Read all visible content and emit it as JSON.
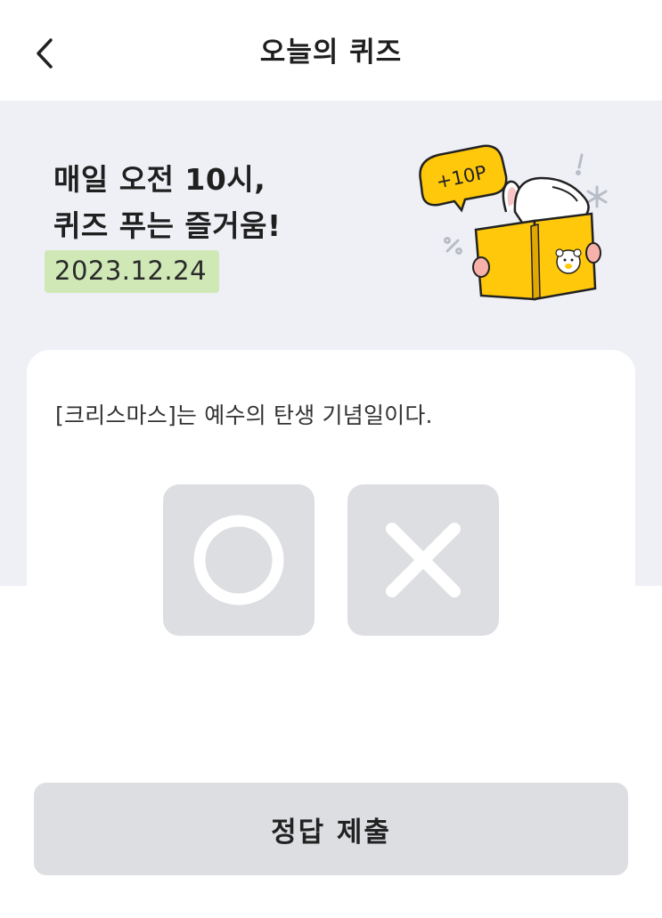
{
  "header": {
    "title": "오늘의 퀴즈",
    "back_icon": "chevron-left-icon"
  },
  "hero": {
    "headline_line1": "매일 오전 10시,",
    "headline_line2": "퀴즈 푸는 즐거움!",
    "date": "2023.12.24",
    "badge_text": "+10P",
    "highlight_color": "#cfe8b6"
  },
  "quiz": {
    "question": "[크리스마스]는 예수의 탄생 기념일이다.",
    "options": [
      {
        "icon": "circle-o-icon",
        "meaning": "true"
      },
      {
        "icon": "cross-x-icon",
        "meaning": "false"
      }
    ]
  },
  "footer": {
    "submit_label": "정답 제출"
  },
  "colors": {
    "hero_bg": "#eef0f6",
    "button_bg": "#dcdee1",
    "book_yellow": "#ffc80a"
  }
}
